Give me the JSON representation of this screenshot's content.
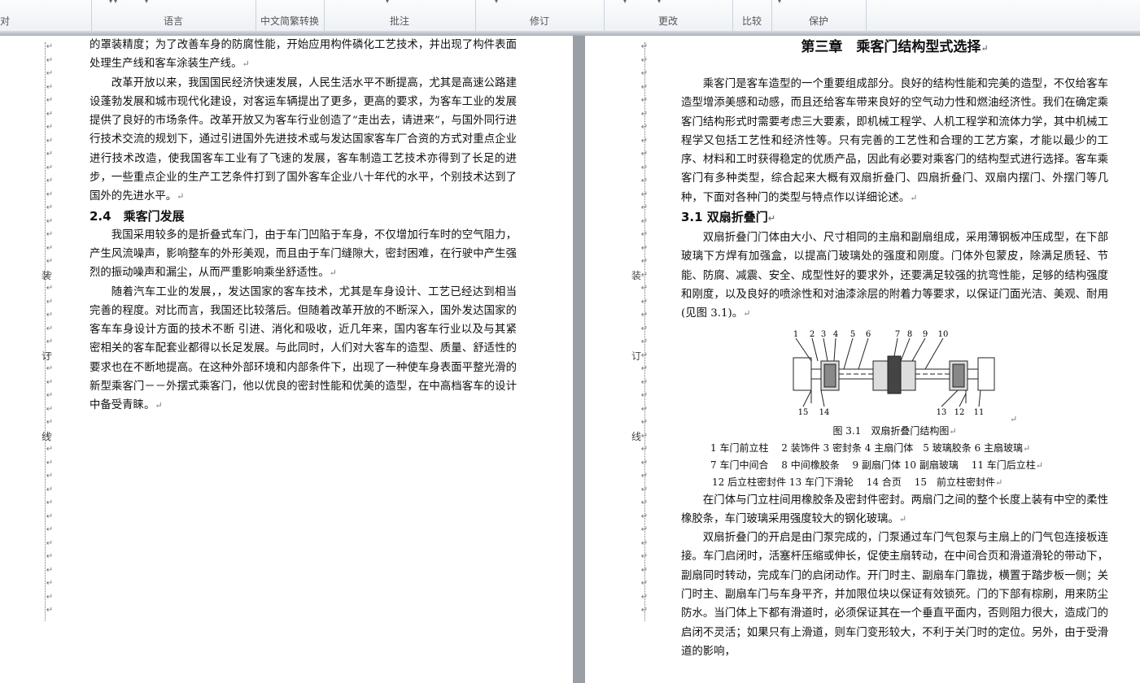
{
  "ribbon": {
    "groups": [
      "对",
      "语言",
      "中文简繁转换",
      "批注",
      "修订",
      "更改",
      "比较",
      "保护"
    ]
  },
  "gutter": {
    "paragraph_mark": "↵",
    "binding_left": [
      "装",
      "订",
      "线"
    ],
    "binding_right": [
      "装",
      "订",
      "线"
    ]
  },
  "left_page": {
    "p1": "的罩装精度；为了改善车身的防腐性能，开始应用构件磷化工艺技术，并出现了构件表面处理生产线和客车涂装生产线。",
    "p2": "改革开放以来，我国国民经济快速发展，人民生活水平不断提高，尤其是高速公路建设蓬勃发展和城市现代化建设，对客运车辆提出了更多，更高的要求，为客车工业的发展提供了良好的市场条件。改革开放又为客车行业创造了“走出去，请进来”，与国外同行进行技术交流的规划下，通过引进国外先进技术或与发达国家客车厂合资的方式对重点企业进行技术改造，使我国客车工业有了飞速的发展，客车制造工艺技术亦得到了长足的进步，一些重点企业的生产工艺条件打到了国外客车企业八十年代的水平，个别技术达到了国外的先进水平。",
    "heading": "2.4　乘客门发展",
    "p3": "我国采用较多的是折叠式车门，由于车门凹陷于车身，不仅增加行车时的空气阻力，产生风流噪声，影响整车的外形美观，而且由于车门缝隙大，密封困难，在行驶中产生强烈的振动噪声和漏尘，从而严重影响乘坐舒适性。",
    "p4": "随着汽车工业的发展，，发达国家的客车技术，尤其是车身设计、工艺已经达到相当完善的程度。对比而言，我国还比较落后。但随着改革开放的不断深入，国外发达国家的客车车身设计方面的技术不断  引进、消化和吸收，近几年来，国内客车行业以及与其紧密相关的客车配套业都得以长足发展。与此同时，人们对大客车的造型、质量、舒适性的要求也在不断地提高。在这种外部环境和内部条件下，出现了一种使车身表面平整光滑的新型乘客门－－外摆式乘客门，他以优良的密封性能和优美的造型，在中高档客车的设计中备受青睐。"
  },
  "right_page": {
    "chapter_title": "第三章　乘客门结构型式选择",
    "p1": "乘客门是客车造型的一个重要组成部分。良好的结构性能和完美的造型，不仅给客车造型增添美感和动感，而且还给客车带来良好的空气动力性和燃油经济性。我们在确定乘客门结构形式时需要考虑三大要素，即机械工程学、人机工程学和流体力学，其中机械工程学又包括工艺性和经济性等。只有完善的工艺性和合理的工艺方案，才能以最少的工序、材料和工时获得稳定的优质产品，因此有必要对乘客门的结构型式进行选择。客车乘客门有多种类型，综合起来大概有双扇折叠门、四扇折叠门、双扇内摆门、外摆门等几种，下面对各种门的类型与特点作以详细论述。",
    "heading": "3.1 双扇折叠门",
    "p2": "双扇折叠门门体由大小、尺寸相同的主扇和副扇组成，采用薄钢板冲压成型，在下部玻璃下方焊有加强盒，以提高门玻璃处的强度和刚度。门体外包蒙皮，除满足质轻、节能、防腐、减震、安全、成型性好的要求外，还要满足较强的抗弯性能，足够的结构强度和刚度，以及良好的喷涂性和对油漆涂层的附着力等要求，以保证门面光洁、美观、耐用(见图 3.1)。",
    "figure_numbers_top": [
      "1",
      "2",
      "3",
      "4",
      "5",
      "6",
      "7",
      "8",
      "9",
      "10"
    ],
    "figure_numbers_bottom": [
      "15",
      "14",
      "13",
      "12",
      "11"
    ],
    "figure_caption": "图 3.1　双扇折叠门结构图",
    "legend_1": "1 车门前立柱　 2 装饰件 3 密封条 4 主扇门体　5 玻璃胶条 6 主扇玻璃",
    "legend_2": "7 车门中间合　 8 中间橡胶条　 9 副扇门体 10 副扇玻璃　 11 车门后立柱",
    "legend_3": "12 后立柱密封件 13 车门下滑轮　 14 合页　 15　前立柱密封件",
    "p3": "在门体与门立柱间用橡胶条及密封件密封。两扇门之间的整个长度上装有中空的柔性橡胶条，车门玻璃采用强度较大的钢化玻璃。",
    "p4": "双扇折叠门的开启是由门泵完成的，门泵通过车门气包泵与主扇上的门气包连接板连接。车门启闭时，活塞杆压缩或伸长，促使主扇转动，在中间合页和滑道滑轮的带动下，副扇同时转动，完成车门的启闭动作。开门时主、副扇车门靠拢，横置于踏步板一侧；关门时主、副扇车门与车身平齐，并加限位块以保证有效锁死。门的下部有棕刷，用来防尘防水。当门体上下都有滑道时，必须保证其在一个垂直平面内，否则阻力很大，造成门的启闭不灵活；如果只有上滑道，则车门变形较大，不利于关门时的定位。另外，由于受滑道的影响，"
  }
}
